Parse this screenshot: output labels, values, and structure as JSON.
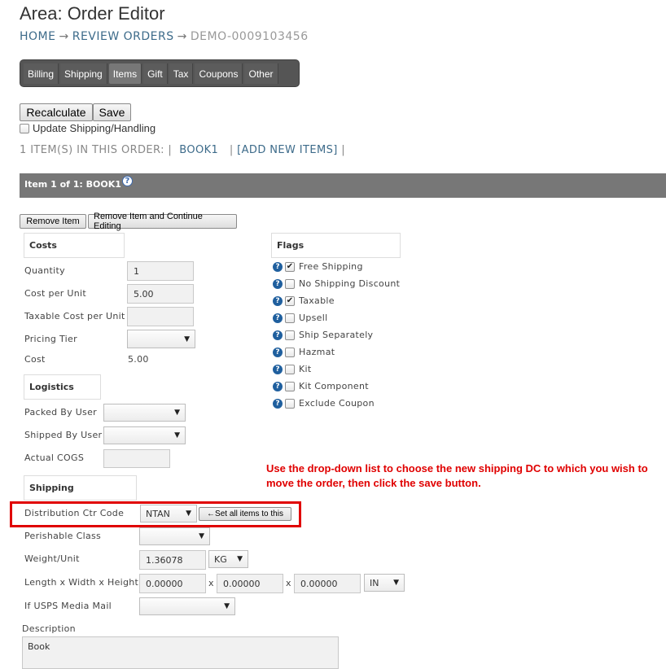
{
  "header": {
    "title": "Area: Order Editor",
    "breadcrumb": {
      "home": "HOME",
      "arrow": "→",
      "review": "REVIEW ORDERS",
      "order_id": "DEMO-0009103456"
    }
  },
  "tabs": [
    "Billing",
    "Shipping",
    "Items",
    "Gift",
    "Tax",
    "Coupons",
    "Other"
  ],
  "active_tab": "Items",
  "toolbar": {
    "recalculate_label": "Recalculate",
    "save_label": "Save",
    "update_shipping_label": "Update Shipping/Handling",
    "update_shipping_checked": false
  },
  "items_summary": {
    "count_text": "1 ITEM(S) IN THIS ORDER: |",
    "item_link": "BOOK1",
    "sep": "|",
    "add_new": "[ADD NEW ITEMS]",
    "sep_end": "|"
  },
  "item_bar": {
    "title": "Item 1 of 1: BOOK1",
    "help": "?"
  },
  "item_buttons": {
    "remove": "Remove Item",
    "remove_continue": "Remove Item and Continue Editing"
  },
  "costs": {
    "heading": "Costs",
    "quantity_label": "Quantity",
    "quantity_value": "1",
    "cost_per_unit_label": "Cost per Unit",
    "cost_per_unit_value": "5.00",
    "taxable_cost_label": "Taxable Cost per Unit",
    "taxable_cost_value": "",
    "pricing_tier_label": "Pricing Tier",
    "pricing_tier_value": "",
    "cost_label": "Cost",
    "cost_value": "5.00"
  },
  "logistics": {
    "heading": "Logistics",
    "packed_by_label": "Packed By User",
    "packed_by_value": "",
    "shipped_by_label": "Shipped By User",
    "shipped_by_value": "",
    "actual_cogs_label": "Actual COGS",
    "actual_cogs_value": ""
  },
  "shipping": {
    "heading": "Shipping",
    "dc_label": "Distribution Ctr Code",
    "dc_value": "NTAN",
    "set_all_label": "←Set all items to this",
    "perishable_label": "Perishable Class",
    "perishable_value": "",
    "weight_label": "Weight/Unit",
    "weight_value": "1.36078",
    "weight_unit": "KG",
    "dims_label": "Length x Width x Height",
    "length": "0.00000",
    "width": "0.00000",
    "height": "0.00000",
    "dims_x": "x",
    "dim_unit": "IN",
    "usps_label": "If USPS Media Mail",
    "usps_value": ""
  },
  "flags": {
    "heading": "Flags",
    "items": [
      {
        "label": "Free Shipping",
        "checked": true
      },
      {
        "label": "No Shipping Discount",
        "checked": false
      },
      {
        "label": "Taxable",
        "checked": true
      },
      {
        "label": "Upsell",
        "checked": false
      },
      {
        "label": "Ship Separately",
        "checked": false
      },
      {
        "label": "Hazmat",
        "checked": false
      },
      {
        "label": "Kit",
        "checked": false
      },
      {
        "label": "Kit Component",
        "checked": false
      },
      {
        "label": "Exclude Coupon",
        "checked": false
      }
    ]
  },
  "description": {
    "label": "Description",
    "value": "Book"
  },
  "annotation": {
    "text": "Use the drop-down list to choose the new shipping DC to which you wish to move the order, then click the save button.",
    "color": "#e00000"
  },
  "colors": {
    "link": "#3d6b8a",
    "tabbar": "#555555",
    "item_bar": "#777777",
    "help_icon": "#1f5f9e"
  }
}
